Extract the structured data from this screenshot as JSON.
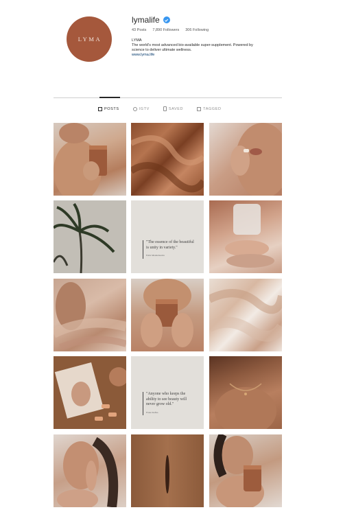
{
  "profile": {
    "avatar_text": "LYMA",
    "username": "lymalife",
    "stats": {
      "posts": "43 Posts",
      "followers": "7,890 Followers",
      "following": "306 Following"
    },
    "bio": {
      "name": "LYMA",
      "line1": "The world's most advanced bio-available super-supplement. Powered by",
      "line2": "science to deliver ultimate wellness.",
      "link": "www.lyma.life"
    },
    "colors": {
      "avatar": "#a5583c",
      "verified": "#3897f0"
    }
  },
  "tabs": [
    {
      "label": "POSTS",
      "icon": "grid-icon",
      "active": true
    },
    {
      "label": "IGTV",
      "icon": "igtv-icon",
      "active": false
    },
    {
      "label": "SAVED",
      "icon": "bookmark-icon",
      "active": false
    },
    {
      "label": "TAGGED",
      "icon": "tag-icon",
      "active": false
    }
  ],
  "posts": [
    {
      "desc": "model-holding-copper-jar"
    },
    {
      "desc": "copper-silk"
    },
    {
      "desc": "woman-taking-capsule"
    },
    {
      "desc": "palm-tree"
    },
    {
      "desc": "quote-tile-1"
    },
    {
      "desc": "hand-with-glass"
    },
    {
      "desc": "body-with-sheer-fabric"
    },
    {
      "desc": "hands-holding-copper-jar"
    },
    {
      "desc": "abstract-beige-texture"
    },
    {
      "desc": "product-flatlay"
    },
    {
      "desc": "quote-tile-2"
    },
    {
      "desc": "glowing-decolletage"
    },
    {
      "desc": "portrait-hand-on-face"
    },
    {
      "desc": "copper-slit-texture"
    },
    {
      "desc": "woman-with-copper-jar"
    }
  ],
  "quotes": {
    "q1": "\"The essence of the beautiful is unity in variety.\"",
    "q1_author": "Felix Mendelssohn",
    "q2": "\"Anyone who keeps the ability to see beauty will never grow old.\"",
    "q2_author": "Franz Kafka"
  }
}
